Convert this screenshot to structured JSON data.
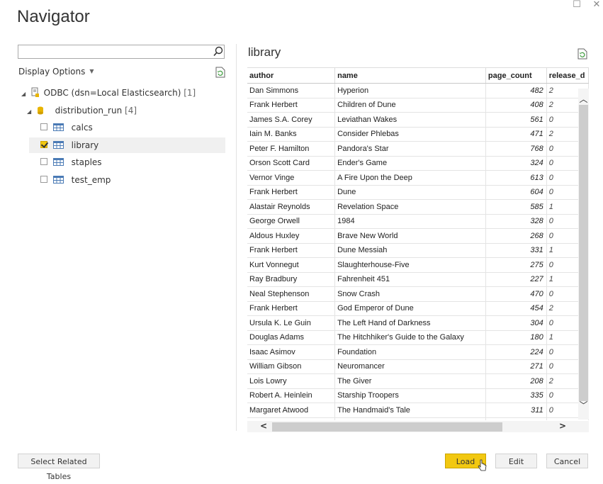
{
  "window": {
    "title": "Navigator",
    "maximize_glyph": "☐",
    "close_glyph": "✕"
  },
  "left_panel": {
    "search": {
      "value": "",
      "placeholder": ""
    },
    "display_options_label": "Display Options",
    "tree": {
      "root": {
        "label": "ODBC (dsn=Local Elasticsearch)",
        "count": "[1]"
      },
      "database": {
        "label": "distribution_run",
        "count": "[4]"
      },
      "tables": [
        {
          "label": "calcs",
          "checked": false
        },
        {
          "label": "library",
          "checked": true
        },
        {
          "label": "staples",
          "checked": false
        },
        {
          "label": "test_emp",
          "checked": false
        }
      ]
    }
  },
  "preview": {
    "title": "library",
    "columns": [
      "author",
      "name",
      "page_count",
      "release_d"
    ],
    "rows": [
      [
        "Dan Simmons",
        "Hyperion",
        "482",
        "2"
      ],
      [
        "Frank Herbert",
        "Children of Dune",
        "408",
        "2"
      ],
      [
        "James S.A. Corey",
        "Leviathan Wakes",
        "561",
        "0"
      ],
      [
        "Iain M. Banks",
        "Consider Phlebas",
        "471",
        "2"
      ],
      [
        "Peter F. Hamilton",
        "Pandora's Star",
        "768",
        "0"
      ],
      [
        "Orson Scott Card",
        "Ender's Game",
        "324",
        "0"
      ],
      [
        "Vernor Vinge",
        "A Fire Upon the Deep",
        "613",
        "0"
      ],
      [
        "Frank Herbert",
        "Dune",
        "604",
        "0"
      ],
      [
        "Alastair Reynolds",
        "Revelation Space",
        "585",
        "1"
      ],
      [
        "George Orwell",
        "1984",
        "328",
        "0"
      ],
      [
        "Aldous Huxley",
        "Brave New World",
        "268",
        "0"
      ],
      [
        "Frank Herbert",
        "Dune Messiah",
        "331",
        "1"
      ],
      [
        "Kurt Vonnegut",
        "Slaughterhouse-Five",
        "275",
        "0"
      ],
      [
        "Ray Bradbury",
        "Fahrenheit 451",
        "227",
        "1"
      ],
      [
        "Neal Stephenson",
        "Snow Crash",
        "470",
        "0"
      ],
      [
        "Frank Herbert",
        "God Emperor of Dune",
        "454",
        "2"
      ],
      [
        "Ursula K. Le Guin",
        "The Left Hand of Darkness",
        "304",
        "0"
      ],
      [
        "Douglas Adams",
        "The Hitchhiker's Guide to the Galaxy",
        "180",
        "1"
      ],
      [
        "Isaac Asimov",
        "Foundation",
        "224",
        "0"
      ],
      [
        "William Gibson",
        "Neuromancer",
        "271",
        "0"
      ],
      [
        "Lois Lowry",
        "The Giver",
        "208",
        "2"
      ],
      [
        "Robert A. Heinlein",
        "Starship Troopers",
        "335",
        "0"
      ],
      [
        "Margaret Atwood",
        "The Handmaid's Tale",
        "311",
        "0"
      ],
      [
        "",
        "",
        "",
        ""
      ]
    ]
  },
  "footer": {
    "select_related_label": "Select Related Tables",
    "load_label": "Load",
    "edit_label": "Edit",
    "cancel_label": "Cancel"
  },
  "colors": {
    "accent_yellow": "#f2c811",
    "db_icon": "#e8b400",
    "table_icon": "#4a7ab5"
  }
}
